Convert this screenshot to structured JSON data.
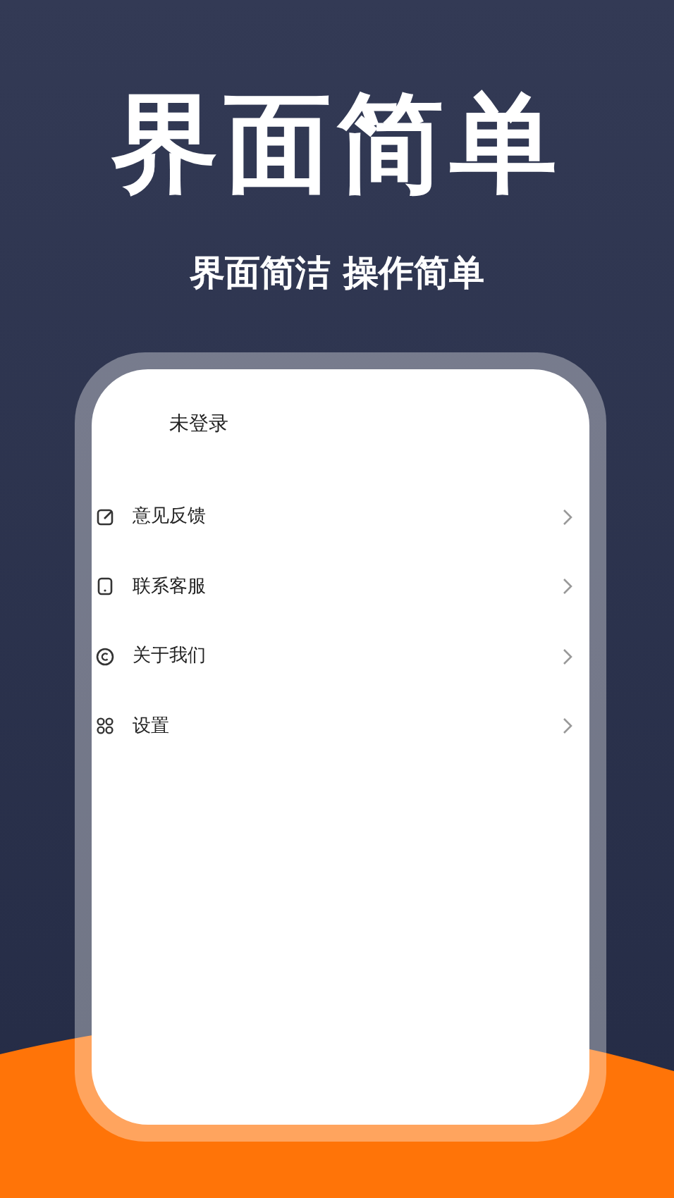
{
  "headline": "界面简单",
  "tagline": "界面简洁 操作简单",
  "phone": {
    "user_status": "未登录",
    "menu": [
      {
        "label": "意见反馈"
      },
      {
        "label": "联系客服"
      },
      {
        "label": "关于我们"
      },
      {
        "label": "设置"
      }
    ]
  }
}
